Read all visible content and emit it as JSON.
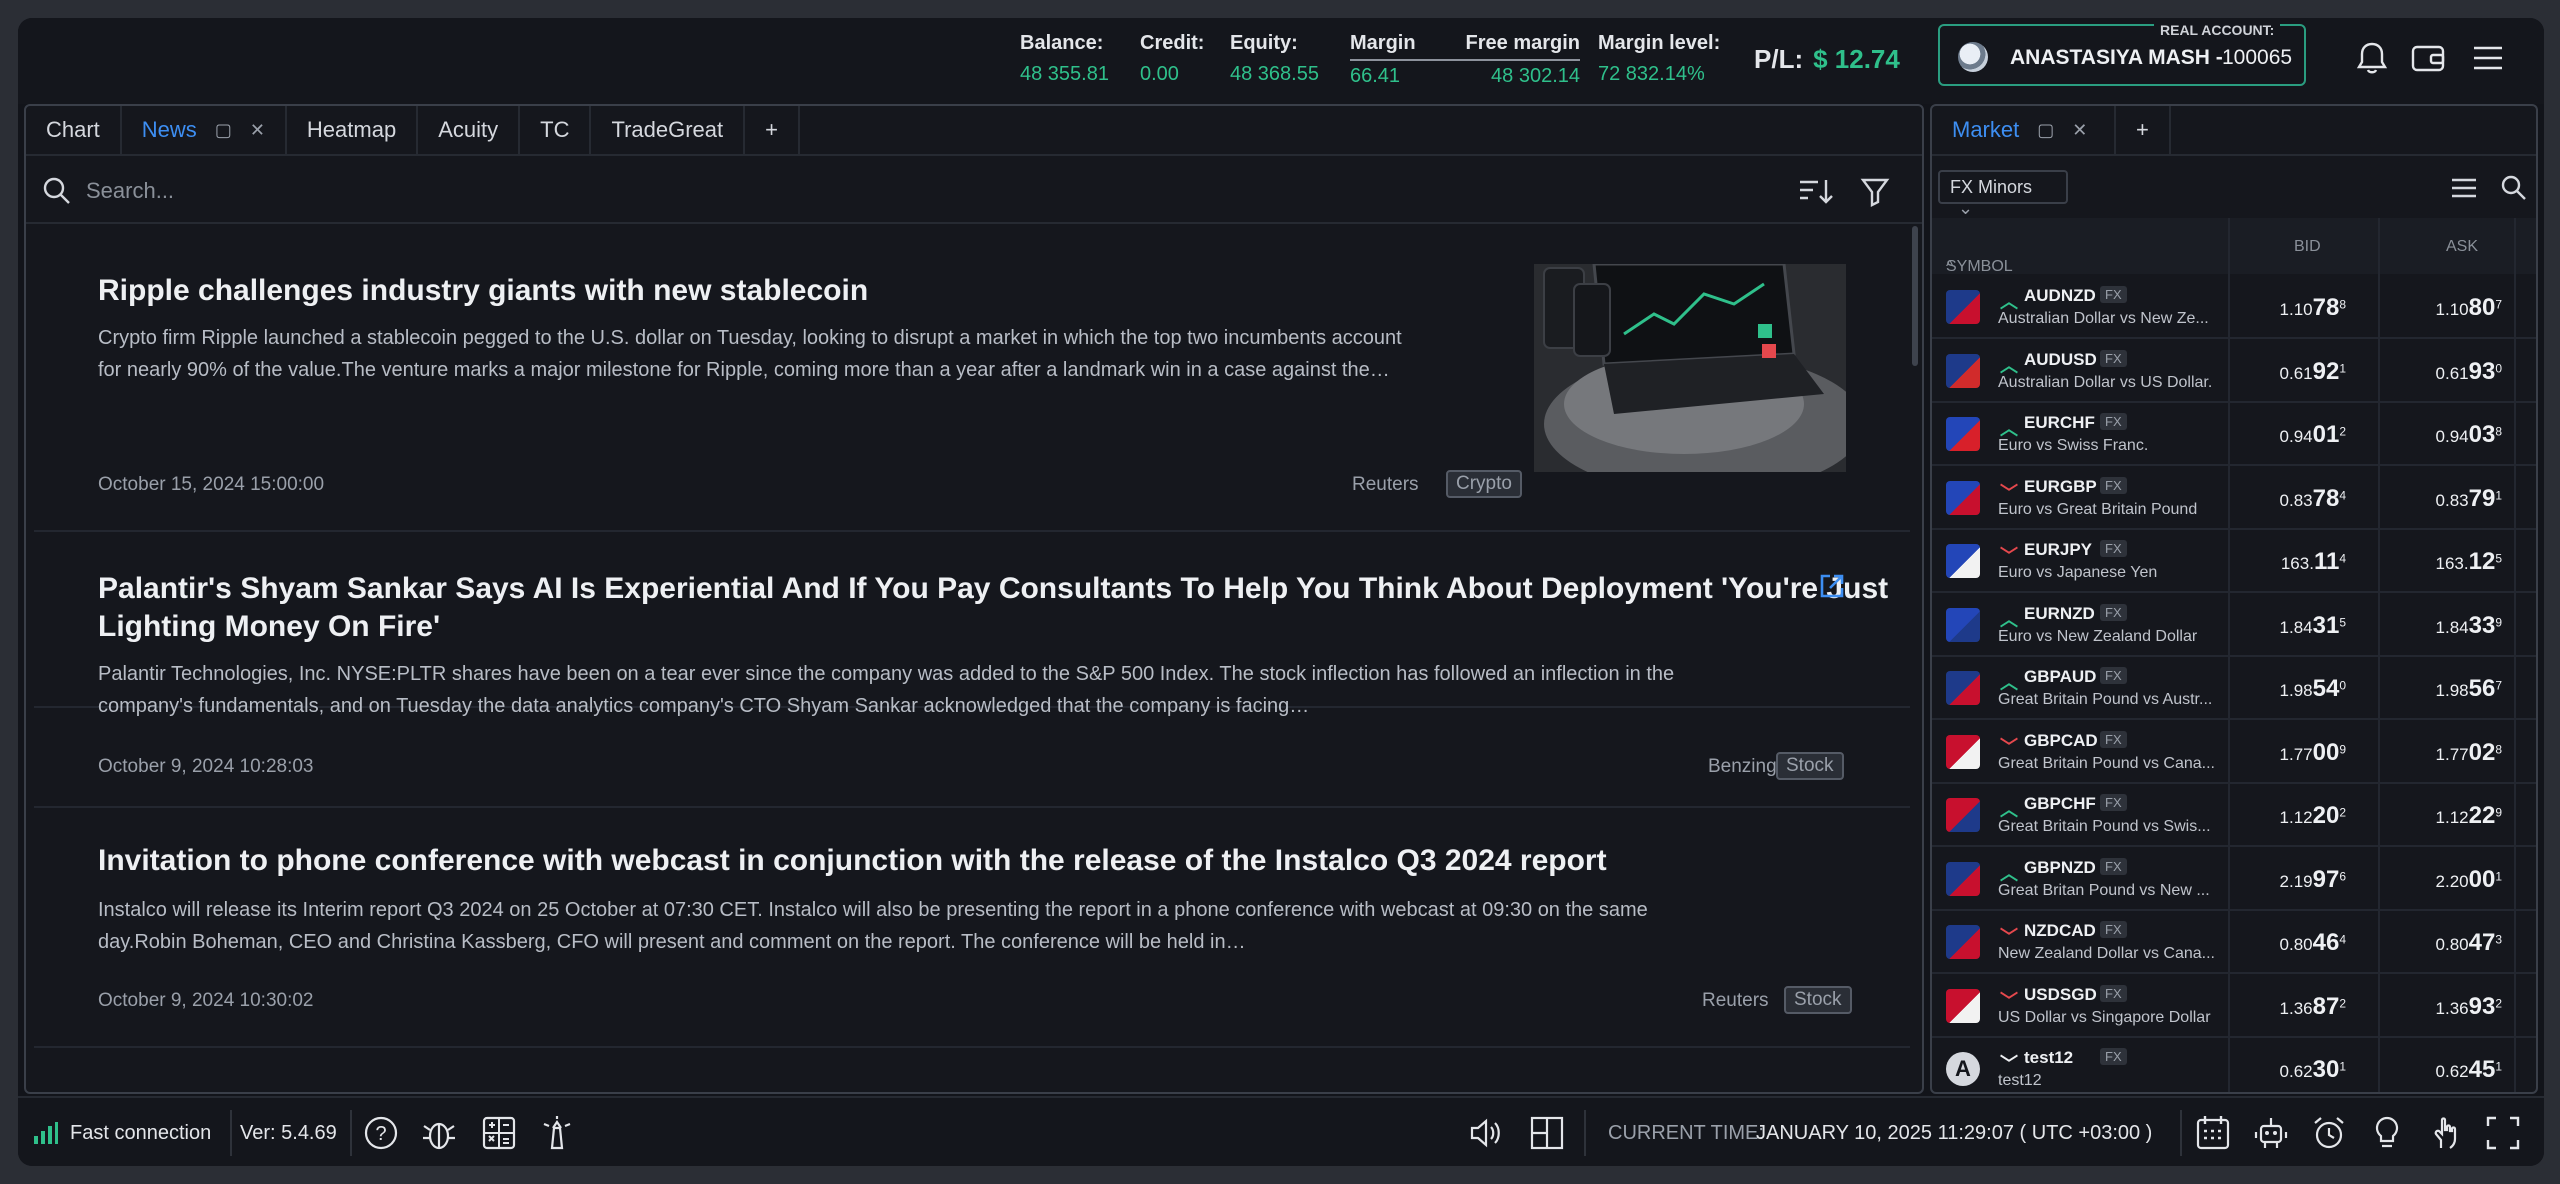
{
  "topbar": {
    "metrics": [
      {
        "label": "Balance:",
        "value": "48 355.81"
      },
      {
        "label": "Credit:",
        "value": "0.00"
      },
      {
        "label": "Equity:",
        "value": "48 368.55"
      },
      {
        "label": "Margin",
        "value": "66.41"
      },
      {
        "label": "Free margin",
        "value": "48 302.14"
      },
      {
        "label": "Margin level:",
        "value": "72 832.14%"
      }
    ],
    "pl_label": "P/L:",
    "pl_value": "$ 12.74",
    "account_tag": "REAL ACCOUNT:",
    "account_name": "ANASTASIYA MASH -",
    "account_number": "100065",
    "icons": [
      "bell-icon",
      "wallet-icon",
      "menu-icon"
    ]
  },
  "news_panel": {
    "tabs": [
      {
        "label": "Chart"
      },
      {
        "label": "News",
        "active": true
      },
      {
        "label": "Heatmap"
      },
      {
        "label": "Acuity"
      },
      {
        "label": "TC"
      },
      {
        "label": "TradeGreat"
      },
      {
        "label": "+"
      }
    ],
    "search_placeholder": "Search...",
    "items": [
      {
        "title": "Ripple challenges industry giants with new stablecoin",
        "body_line1": "Crypto firm Ripple launched a stablecoin pegged to the U.S. dollar on Tuesday, looking to disrupt a market in which the top two incumbents account",
        "body_line2": "for nearly 90% of the value.The venture marks a major milestone for Ripple, coming more than a year after a landmark win in a case against the…",
        "date": "October 15, 2024 15:00:00",
        "source": "Reuters",
        "tag": "Crypto"
      },
      {
        "title_line1": "Palantir's Shyam Sankar Says AI Is Experiential And If You Pay Consultants To Help You Think About Deployment 'You're Just",
        "title_line2": "Lighting Money On Fire'",
        "body_line1": "Palantir Technologies, Inc. NYSE:PLTR shares have been on a tear ever since the company was added to the S&P 500 Index. The stock inflection has followed an inflection in the",
        "body_line2": "company's fundamentals, and on Tuesday the data analytics company's CTO Shyam Sankar acknowledged that the company is facing…",
        "date": "October 9, 2024 10:28:03",
        "source": "Benzinga",
        "tag": "Stock"
      },
      {
        "title": "Invitation to phone conference with webcast in conjunction with the release of the Instalco Q3 2024 report",
        "body_line1": "Instalco will release its Interim report Q3 2024 on 25 October at 07:30 CET. Instalco will also be presenting the report in a phone conference with webcast at 09:30 on the same",
        "body_line2": "day.Robin Boheman, CEO and Christina Kassberg, CFO will present and comment on the report. The conference will be held in…",
        "date": "October 9, 2024 10:30:02",
        "source": "Reuters",
        "tag": "Stock"
      }
    ]
  },
  "market_panel": {
    "tabs": [
      {
        "label": "Market",
        "active": true
      },
      {
        "label": "+"
      }
    ],
    "filter": "FX Minors",
    "headers": {
      "symbol": "SYMBOL",
      "bid": "BID",
      "ask": "ASK"
    },
    "rows": [
      {
        "symbol": "AUDNZD",
        "desc": "Australian Dollar vs New Ze...",
        "dir": "up",
        "bid": [
          "1.10",
          "78",
          "8"
        ],
        "ask": [
          "1.10",
          "80",
          "7"
        ],
        "flag": [
          "#1e3a8a",
          "#c8102e"
        ]
      },
      {
        "symbol": "AUDUSD",
        "desc": "Australian Dollar vs US Dollar.",
        "dir": "up",
        "bid": [
          "0.61",
          "92",
          "1"
        ],
        "ask": [
          "0.61",
          "93",
          "0"
        ],
        "flag": [
          "#1e3a8a",
          "#d12b2b"
        ]
      },
      {
        "symbol": "EURCHF",
        "desc": "Euro vs Swiss Franc.",
        "dir": "up",
        "bid": [
          "0.94",
          "01",
          "2"
        ],
        "ask": [
          "0.94",
          "03",
          "8"
        ],
        "flag": [
          "#2346b8",
          "#d8202a"
        ]
      },
      {
        "symbol": "EURGBP",
        "desc": "Euro vs Great Britain Pound",
        "dir": "down",
        "bid": [
          "0.83",
          "78",
          "4"
        ],
        "ask": [
          "0.83",
          "79",
          "1"
        ],
        "flag": [
          "#2346b8",
          "#c8102e"
        ]
      },
      {
        "symbol": "EURJPY",
        "desc": "Euro vs Japanese Yen",
        "dir": "down",
        "bid": [
          "163.",
          "11",
          "4"
        ],
        "ask": [
          "163.",
          "12",
          "5"
        ],
        "flag": [
          "#2346b8",
          "#f2f2f2"
        ]
      },
      {
        "symbol": "EURNZD",
        "desc": "Euro vs New Zealand Dollar",
        "dir": "up",
        "bid": [
          "1.84",
          "31",
          "5"
        ],
        "ask": [
          "1.84",
          "33",
          "9"
        ],
        "flag": [
          "#2346b8",
          "#1e3a8a"
        ]
      },
      {
        "symbol": "GBPAUD",
        "desc": "Great Britain Pound vs Austr...",
        "dir": "up",
        "bid": [
          "1.98",
          "54",
          "0"
        ],
        "ask": [
          "1.98",
          "56",
          "7"
        ],
        "flag": [
          "#1e3a8a",
          "#c8102e"
        ]
      },
      {
        "symbol": "GBPCAD",
        "desc": "Great Britain Pound vs Cana...",
        "dir": "down",
        "bid": [
          "1.77",
          "00",
          "9"
        ],
        "ask": [
          "1.77",
          "02",
          "8"
        ],
        "flag": [
          "#c8102e",
          "#f2f2f2"
        ]
      },
      {
        "symbol": "GBPCHF",
        "desc": "Great Britain Pound vs Swis...",
        "dir": "up",
        "bid": [
          "1.12",
          "20",
          "2"
        ],
        "ask": [
          "1.12",
          "22",
          "9"
        ],
        "flag": [
          "#c8102e",
          "#1e3a8a"
        ]
      },
      {
        "symbol": "GBPNZD",
        "desc": "Great Britan Pound vs New ...",
        "dir": "up",
        "bid": [
          "2.19",
          "97",
          "6"
        ],
        "ask": [
          "2.20",
          "00",
          "1"
        ],
        "flag": [
          "#1e3a8a",
          "#c8102e"
        ]
      },
      {
        "symbol": "NZDCAD",
        "desc": "New Zealand Dollar vs Cana...",
        "dir": "down",
        "bid": [
          "0.80",
          "46",
          "4"
        ],
        "ask": [
          "0.80",
          "47",
          "3"
        ],
        "flag": [
          "#1e3a8a",
          "#c8102e"
        ]
      },
      {
        "symbol": "USDSGD",
        "desc": "US Dollar vs Singapore Dollar",
        "dir": "down",
        "bid": [
          "1.36",
          "87",
          "2"
        ],
        "ask": [
          "1.36",
          "93",
          "2"
        ],
        "flag": [
          "#c8102e",
          "#f2f2f2"
        ]
      },
      {
        "symbol": "test12",
        "desc": "test12",
        "dir": "down-white",
        "bid": [
          "0.62",
          "30",
          "1"
        ],
        "ask": [
          "0.62",
          "45",
          "1"
        ],
        "flag": [
          "#d5d8de",
          "#d5d8de"
        ],
        "letter": "A"
      }
    ],
    "fx_badge": "FX"
  },
  "bottombar": {
    "connection": "Fast connection",
    "version": "Ver: 5.4.69",
    "time_label": "CURRENT TIME:",
    "time_value": "JANUARY 10, 2025 11:29:07 ( UTC +03:00 )"
  },
  "colors": {
    "accent": "#3d8ef2",
    "up": "#2fc08b",
    "down": "#e5484d",
    "account_border": "#2a9d80"
  }
}
